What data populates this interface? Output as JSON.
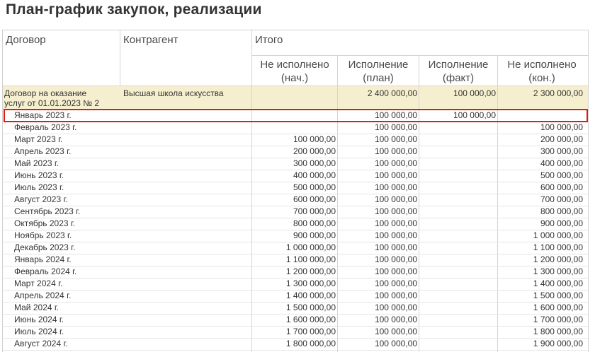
{
  "title": "План-график закупок, реализации",
  "header": {
    "contract": "Договор",
    "counterparty": "Контрагент",
    "total": "Итого",
    "col1": [
      "Не исполнено",
      "(нач.)"
    ],
    "col2": [
      "Исполнение",
      "(план)"
    ],
    "col3": [
      "Исполнение",
      "(факт)"
    ],
    "col4": [
      "Не исполнено",
      "(кон.)"
    ]
  },
  "group": {
    "contract_line1": "Договор на оказание",
    "contract_line2": "услуг от 01.01.2023 № 2",
    "counterparty": "Высшая школа искусства",
    "not_done_start": "",
    "plan": "2 400 000,00",
    "fact": "100 000,00",
    "not_done_end": "2 300 000,00"
  },
  "rows": [
    {
      "label": "Январь 2023 г.",
      "start": "",
      "plan": "100 000,00",
      "fact": "100 000,00",
      "end": ""
    },
    {
      "label": "Февраль 2023 г.",
      "start": "",
      "plan": "100 000,00",
      "fact": "",
      "end": "100 000,00"
    },
    {
      "label": "Март 2023 г.",
      "start": "100 000,00",
      "plan": "100 000,00",
      "fact": "",
      "end": "200 000,00"
    },
    {
      "label": "Апрель 2023 г.",
      "start": "200 000,00",
      "plan": "100 000,00",
      "fact": "",
      "end": "300 000,00"
    },
    {
      "label": "Май 2023 г.",
      "start": "300 000,00",
      "plan": "100 000,00",
      "fact": "",
      "end": "400 000,00"
    },
    {
      "label": "Июнь 2023 г.",
      "start": "400 000,00",
      "plan": "100 000,00",
      "fact": "",
      "end": "500 000,00"
    },
    {
      "label": "Июль 2023 г.",
      "start": "500 000,00",
      "plan": "100 000,00",
      "fact": "",
      "end": "600 000,00"
    },
    {
      "label": "Август 2023 г.",
      "start": "600 000,00",
      "plan": "100 000,00",
      "fact": "",
      "end": "700 000,00"
    },
    {
      "label": "Сентябрь 2023 г.",
      "start": "700 000,00",
      "plan": "100 000,00",
      "fact": "",
      "end": "800 000,00"
    },
    {
      "label": "Октябрь 2023 г.",
      "start": "800 000,00",
      "plan": "100 000,00",
      "fact": "",
      "end": "900 000,00"
    },
    {
      "label": "Ноябрь 2023 г.",
      "start": "900 000,00",
      "plan": "100 000,00",
      "fact": "",
      "end": "1 000 000,00"
    },
    {
      "label": "Декабрь 2023 г.",
      "start": "1 000 000,00",
      "plan": "100 000,00",
      "fact": "",
      "end": "1 100 000,00"
    },
    {
      "label": "Январь 2024 г.",
      "start": "1 100 000,00",
      "plan": "100 000,00",
      "fact": "",
      "end": "1 200 000,00"
    },
    {
      "label": "Февраль 2024 г.",
      "start": "1 200 000,00",
      "plan": "100 000,00",
      "fact": "",
      "end": "1 300 000,00"
    },
    {
      "label": "Март 2024 г.",
      "start": "1 300 000,00",
      "plan": "100 000,00",
      "fact": "",
      "end": "1 400 000,00"
    },
    {
      "label": "Апрель 2024 г.",
      "start": "1 400 000,00",
      "plan": "100 000,00",
      "fact": "",
      "end": "1 500 000,00"
    },
    {
      "label": "Май 2024 г.",
      "start": "1 500 000,00",
      "plan": "100 000,00",
      "fact": "",
      "end": "1 600 000,00"
    },
    {
      "label": "Июнь 2024 г.",
      "start": "1 600 000,00",
      "plan": "100 000,00",
      "fact": "",
      "end": "1 700 000,00"
    },
    {
      "label": "Июль 2024 г.",
      "start": "1 700 000,00",
      "plan": "100 000,00",
      "fact": "",
      "end": "1 800 000,00"
    },
    {
      "label": "Август 2024 г.",
      "start": "1 800 000,00",
      "plan": "100 000,00",
      "fact": "",
      "end": "1 900 000,00"
    }
  ],
  "colors": {
    "group_background": "#f6efcf",
    "highlight_border": "#e01b1b",
    "grid_line": "#d4d4d4"
  }
}
